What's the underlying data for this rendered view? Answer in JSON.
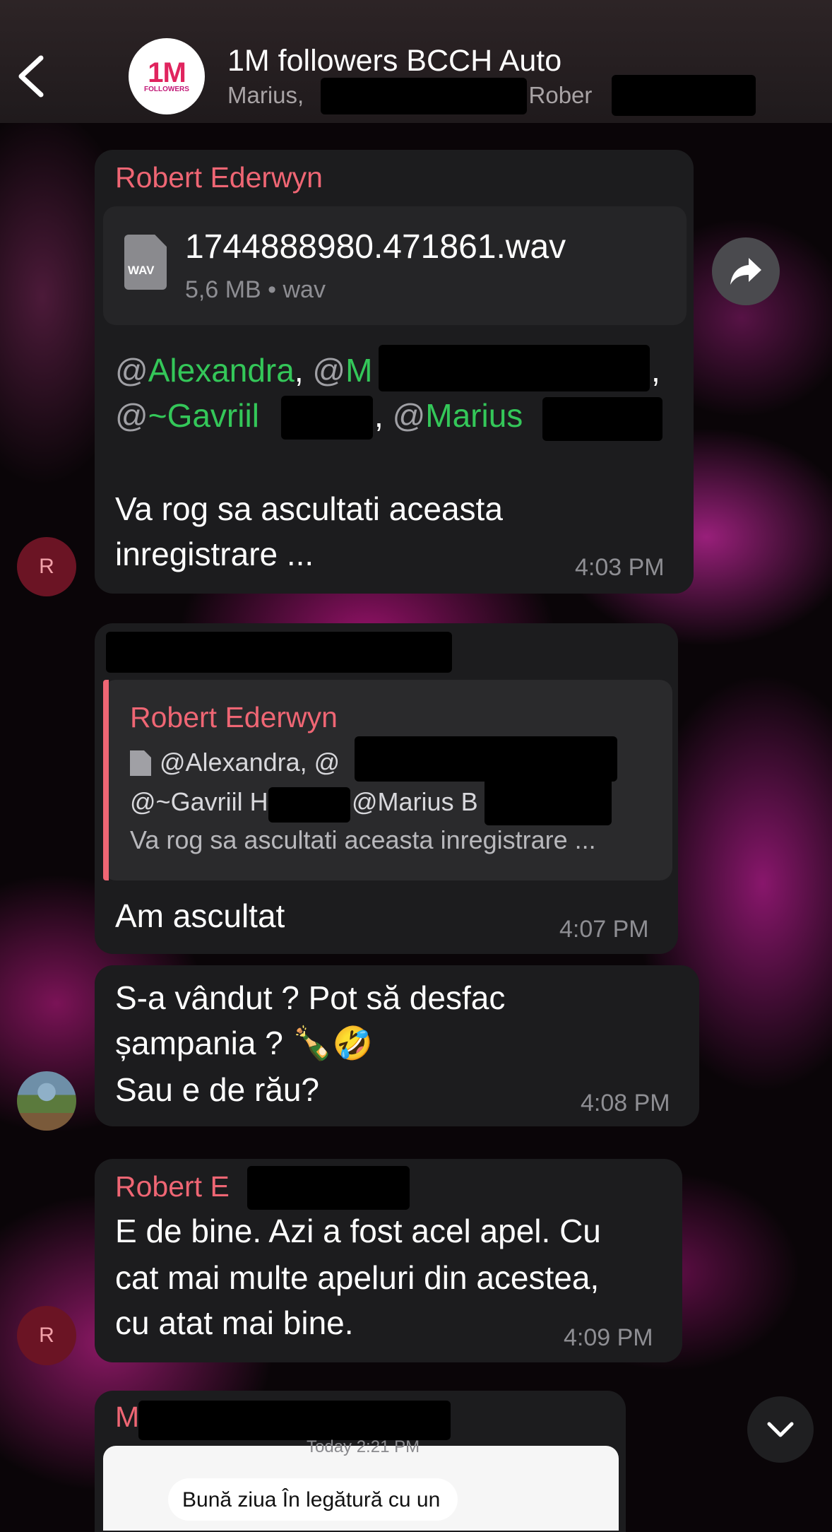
{
  "header": {
    "title": "1M followers BCCH Auto",
    "members_prefix": "Marius,",
    "members_mid": ", Rober",
    "logo_big": "1M",
    "logo_small": "FOLLOWERS"
  },
  "messages": [
    {
      "sender": "Robert Ederwyn",
      "file_name": "1744888980.471861.wav",
      "file_meta": "5,6 MB • wav",
      "file_ext": "WAV",
      "mention_1": "Alexandra",
      "mention_2_prefix": "@M",
      "mention_3": "~Gavriil",
      "mention_4": "Marius",
      "text_line_1": "Va rog sa ascultati aceasta",
      "text_line_2": "inregistrare ...",
      "time": "4:03 PM",
      "avatar_letter": "R"
    },
    {
      "reply_sender": "Robert Ederwyn",
      "reply_line_1": "@Alexandra, @",
      "reply_line_2a": "@~Gavriil H",
      "reply_line_2b": "@Marius B",
      "reply_line_3": "Va rog sa ascultati aceasta inregistrare ...",
      "text": "Am ascultat",
      "time": "4:07 PM"
    },
    {
      "text_line_1": "S-a vândut ? Pot să desfac",
      "text_line_2": "șampania ? 🍾🤣",
      "text_line_3": "Sau e de rău?",
      "time": "4:08 PM"
    },
    {
      "sender": "Robert E",
      "text_line_1": "E de bine. Azi a fost acel apel. Cu",
      "text_line_2": "cat mai multe apeluri din acestea,",
      "text_line_3": "cu atat mai bine.",
      "time": "4:09 PM",
      "avatar_letter": "R"
    },
    {
      "sender_initial": "M",
      "shot_time": "Today 2:21 PM",
      "shot_text": "Bună ziua În legătură cu un"
    }
  ],
  "icons": {
    "back": "chevron-left-icon",
    "forward": "share-arrow-icon",
    "scroll_down": "chevron-down-icon",
    "file": "document-icon"
  },
  "colors": {
    "sender": "#ef6674",
    "mention": "#34c759",
    "bubble": "#1c1c1e"
  }
}
